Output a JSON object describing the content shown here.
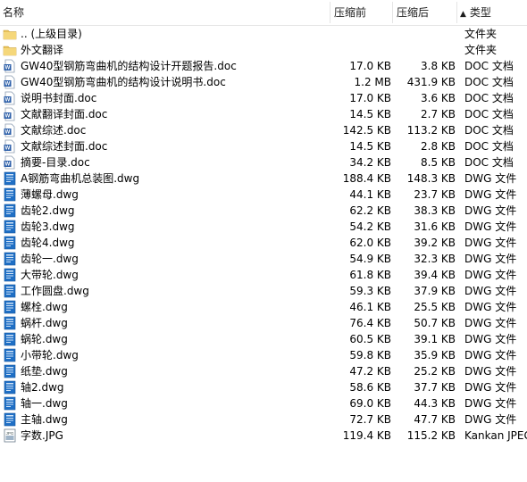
{
  "columns": {
    "name": "名称",
    "compressed": "压缩前",
    "original": "压缩后",
    "type": "类型"
  },
  "files": [
    {
      "icon": "folder-icon",
      "name": ".. (上级目录)",
      "compressed": "",
      "original": "",
      "type": "文件夹"
    },
    {
      "icon": "folder-icon",
      "name": "外文翻译",
      "compressed": "",
      "original": "",
      "type": "文件夹"
    },
    {
      "icon": "doc-file-icon",
      "name": "GW40型钢筋弯曲机的结构设计开题报告.doc",
      "compressed": "17.0 KB",
      "original": "3.8 KB",
      "type": "DOC 文档"
    },
    {
      "icon": "doc-file-icon",
      "name": "GW40型钢筋弯曲机的结构设计说明书.doc",
      "compressed": "1.2 MB",
      "original": "431.9 KB",
      "type": "DOC 文档"
    },
    {
      "icon": "doc-file-icon",
      "name": "说明书封面.doc",
      "compressed": "17.0 KB",
      "original": "3.6 KB",
      "type": "DOC 文档"
    },
    {
      "icon": "doc-file-icon",
      "name": "文献翻译封面.doc",
      "compressed": "14.5 KB",
      "original": "2.7 KB",
      "type": "DOC 文档"
    },
    {
      "icon": "doc-file-icon",
      "name": "文献综述.doc",
      "compressed": "142.5 KB",
      "original": "113.2 KB",
      "type": "DOC 文档"
    },
    {
      "icon": "doc-file-icon",
      "name": "文献综述封面.doc",
      "compressed": "14.5 KB",
      "original": "2.8 KB",
      "type": "DOC 文档"
    },
    {
      "icon": "doc-file-icon",
      "name": "摘要-目录.doc",
      "compressed": "34.2 KB",
      "original": "8.5 KB",
      "type": "DOC 文档"
    },
    {
      "icon": "dwg-file-icon",
      "name": "A钢筋弯曲机总装图.dwg",
      "compressed": "188.4 KB",
      "original": "148.3 KB",
      "type": "DWG 文件"
    },
    {
      "icon": "dwg-file-icon",
      "name": "薄螺母.dwg",
      "compressed": "44.1 KB",
      "original": "23.7 KB",
      "type": "DWG 文件"
    },
    {
      "icon": "dwg-file-icon",
      "name": "齿轮2.dwg",
      "compressed": "62.2 KB",
      "original": "38.3 KB",
      "type": "DWG 文件"
    },
    {
      "icon": "dwg-file-icon",
      "name": "齿轮3.dwg",
      "compressed": "54.2 KB",
      "original": "31.6 KB",
      "type": "DWG 文件"
    },
    {
      "icon": "dwg-file-icon",
      "name": "齿轮4.dwg",
      "compressed": "62.0 KB",
      "original": "39.2 KB",
      "type": "DWG 文件"
    },
    {
      "icon": "dwg-file-icon",
      "name": "齿轮一.dwg",
      "compressed": "54.9 KB",
      "original": "32.3 KB",
      "type": "DWG 文件"
    },
    {
      "icon": "dwg-file-icon",
      "name": "大带轮.dwg",
      "compressed": "61.8 KB",
      "original": "39.4 KB",
      "type": "DWG 文件"
    },
    {
      "icon": "dwg-file-icon",
      "name": "工作圆盘.dwg",
      "compressed": "59.3 KB",
      "original": "37.9 KB",
      "type": "DWG 文件"
    },
    {
      "icon": "dwg-file-icon",
      "name": "螺栓.dwg",
      "compressed": "46.1 KB",
      "original": "25.5 KB",
      "type": "DWG 文件"
    },
    {
      "icon": "dwg-file-icon",
      "name": "蜗杆.dwg",
      "compressed": "76.4 KB",
      "original": "50.7 KB",
      "type": "DWG 文件"
    },
    {
      "icon": "dwg-file-icon",
      "name": "蜗轮.dwg",
      "compressed": "60.5 KB",
      "original": "39.1 KB",
      "type": "DWG 文件"
    },
    {
      "icon": "dwg-file-icon",
      "name": "小带轮.dwg",
      "compressed": "59.8 KB",
      "original": "35.9 KB",
      "type": "DWG 文件"
    },
    {
      "icon": "dwg-file-icon",
      "name": "纸垫.dwg",
      "compressed": "47.2 KB",
      "original": "25.2 KB",
      "type": "DWG 文件"
    },
    {
      "icon": "dwg-file-icon",
      "name": "轴2.dwg",
      "compressed": "58.6 KB",
      "original": "37.7 KB",
      "type": "DWG 文件"
    },
    {
      "icon": "dwg-file-icon",
      "name": "轴一.dwg",
      "compressed": "69.0 KB",
      "original": "44.3 KB",
      "type": "DWG 文件"
    },
    {
      "icon": "dwg-file-icon",
      "name": "主轴.dwg",
      "compressed": "72.7 KB",
      "original": "47.7 KB",
      "type": "DWG 文件"
    },
    {
      "icon": "jpg-file-icon",
      "name": "字数.JPG",
      "compressed": "119.4 KB",
      "original": "115.2 KB",
      "type": "Kankan JPEG 图像"
    }
  ],
  "colors": {
    "folder": "#e8c25a",
    "doc": "#2b5ea8",
    "dwg": "#1f6fc5",
    "jpg": "#6a7a8a"
  }
}
